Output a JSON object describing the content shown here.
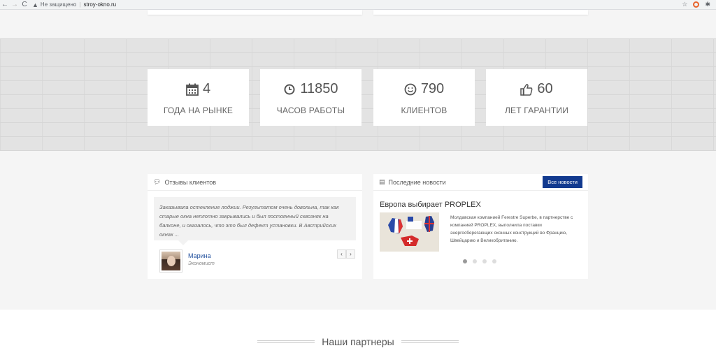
{
  "browser": {
    "back": "←",
    "forward": "→",
    "reload": "C",
    "security_text": "Не защищено",
    "separator": "|",
    "url": "stroy-okno.ru",
    "star": "☆",
    "puzzle": "✱"
  },
  "stats": [
    {
      "icon": "calendar-icon",
      "value": "4",
      "label": "ГОДА НА РЫНКЕ"
    },
    {
      "icon": "clock-icon",
      "value": "11850",
      "label": "ЧАСОВ РАБОТЫ"
    },
    {
      "icon": "smile-icon",
      "value": "790",
      "label": "КЛИЕНТОВ"
    },
    {
      "icon": "thumbs-up-icon",
      "value": "60",
      "label": "ЛЕТ ГАРАНТИИ"
    }
  ],
  "reviews": {
    "heading": "Отзывы клиентов",
    "text": "Заказывала остекление лоджии. Результатом очень довольна, так как старые окна неплотно закрывались и был постоянный сквозняк на балконе, и оказалось, что это был дефект установки. В Австрийских окнах ...",
    "name": "Марина",
    "role": "Экономист",
    "prev": "‹",
    "next": "›"
  },
  "news": {
    "heading": "Последние новости",
    "all_button": "Все новости",
    "title": "Европа выбирает PROPLEX",
    "text": "Молдавская компанией Ferestre Superbe, в партнерстве с компанией PROPLEX, выполнила поставки энергосберегающих оконных конструкций во Францию, Швейцарию и Великобританию.",
    "image_label": "PROPLEX",
    "dots_count": 4,
    "active_dot": 0
  },
  "partners": {
    "title": "Наши партнеры"
  },
  "colors": {
    "accent_button": "#123a8f",
    "link": "#1f4e9c"
  }
}
